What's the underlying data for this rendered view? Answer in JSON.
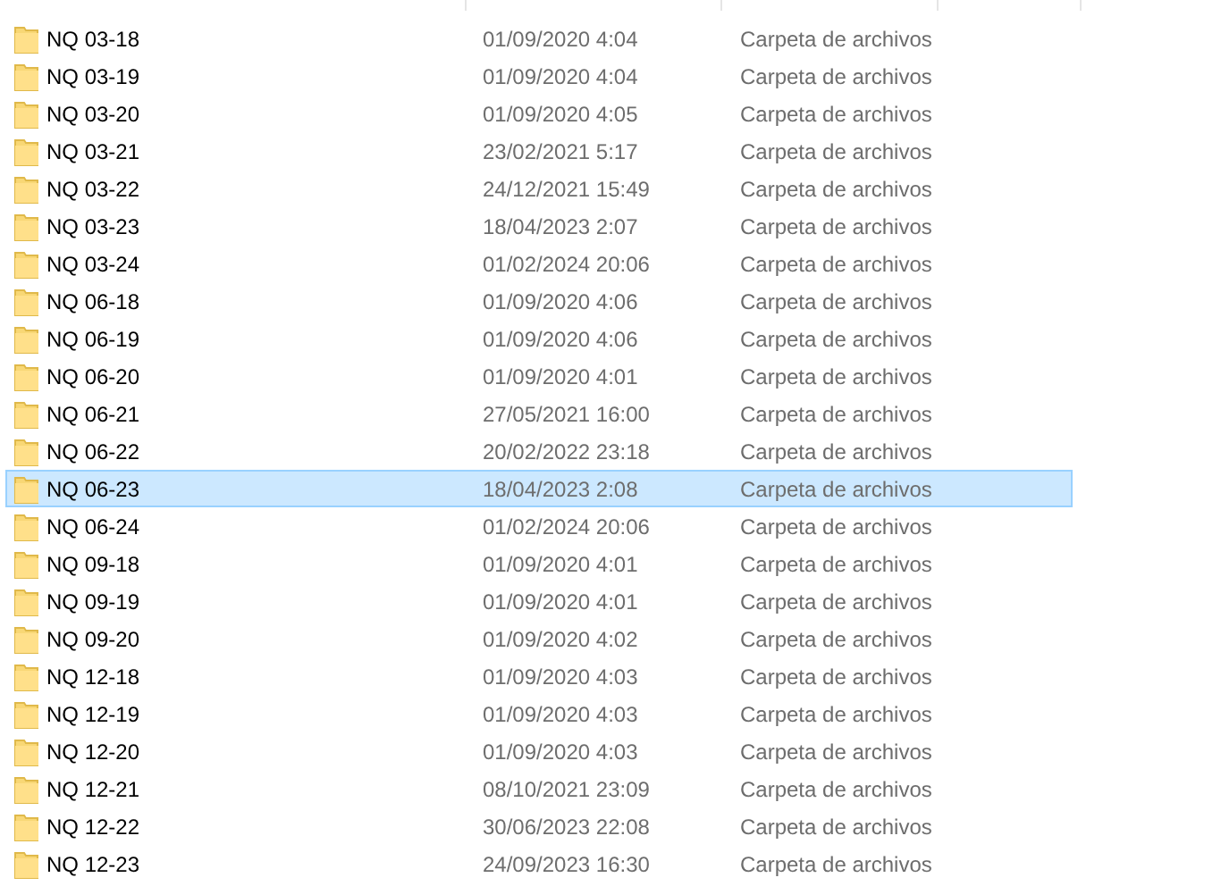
{
  "files": [
    {
      "name": "NQ 03-18",
      "modified": "01/09/2020 4:04",
      "type": "Carpeta de archivos",
      "selected": false
    },
    {
      "name": "NQ 03-19",
      "modified": "01/09/2020 4:04",
      "type": "Carpeta de archivos",
      "selected": false
    },
    {
      "name": "NQ 03-20",
      "modified": "01/09/2020 4:05",
      "type": "Carpeta de archivos",
      "selected": false
    },
    {
      "name": "NQ 03-21",
      "modified": "23/02/2021 5:17",
      "type": "Carpeta de archivos",
      "selected": false
    },
    {
      "name": "NQ 03-22",
      "modified": "24/12/2021 15:49",
      "type": "Carpeta de archivos",
      "selected": false
    },
    {
      "name": "NQ 03-23",
      "modified": "18/04/2023 2:07",
      "type": "Carpeta de archivos",
      "selected": false
    },
    {
      "name": "NQ 03-24",
      "modified": "01/02/2024 20:06",
      "type": "Carpeta de archivos",
      "selected": false
    },
    {
      "name": "NQ 06-18",
      "modified": "01/09/2020 4:06",
      "type": "Carpeta de archivos",
      "selected": false
    },
    {
      "name": "NQ 06-19",
      "modified": "01/09/2020 4:06",
      "type": "Carpeta de archivos",
      "selected": false
    },
    {
      "name": "NQ 06-20",
      "modified": "01/09/2020 4:01",
      "type": "Carpeta de archivos",
      "selected": false
    },
    {
      "name": "NQ 06-21",
      "modified": "27/05/2021 16:00",
      "type": "Carpeta de archivos",
      "selected": false
    },
    {
      "name": "NQ 06-22",
      "modified": "20/02/2022 23:18",
      "type": "Carpeta de archivos",
      "selected": false
    },
    {
      "name": "NQ 06-23",
      "modified": "18/04/2023 2:08",
      "type": "Carpeta de archivos",
      "selected": true
    },
    {
      "name": "NQ 06-24",
      "modified": "01/02/2024 20:06",
      "type": "Carpeta de archivos",
      "selected": false
    },
    {
      "name": "NQ 09-18",
      "modified": "01/09/2020 4:01",
      "type": "Carpeta de archivos",
      "selected": false
    },
    {
      "name": "NQ 09-19",
      "modified": "01/09/2020 4:01",
      "type": "Carpeta de archivos",
      "selected": false
    },
    {
      "name": "NQ 09-20",
      "modified": "01/09/2020 4:02",
      "type": "Carpeta de archivos",
      "selected": false
    },
    {
      "name": "NQ 12-18",
      "modified": "01/09/2020 4:03",
      "type": "Carpeta de archivos",
      "selected": false
    },
    {
      "name": "NQ 12-19",
      "modified": "01/09/2020 4:03",
      "type": "Carpeta de archivos",
      "selected": false
    },
    {
      "name": "NQ 12-20",
      "modified": "01/09/2020 4:03",
      "type": "Carpeta de archivos",
      "selected": false
    },
    {
      "name": "NQ 12-21",
      "modified": "08/10/2021 23:09",
      "type": "Carpeta de archivos",
      "selected": false
    },
    {
      "name": "NQ 12-22",
      "modified": "30/06/2023 22:08",
      "type": "Carpeta de archivos",
      "selected": false
    },
    {
      "name": "NQ 12-23",
      "modified": "24/09/2023 16:30",
      "type": "Carpeta de archivos",
      "selected": false
    }
  ]
}
